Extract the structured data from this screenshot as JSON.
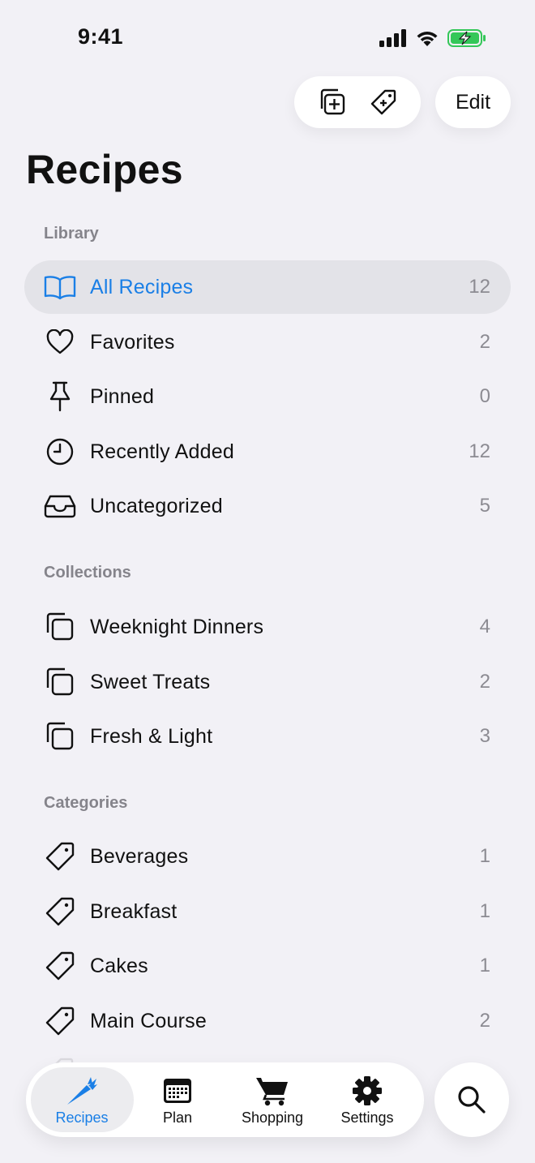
{
  "status": {
    "time": "9:41"
  },
  "toolbar": {
    "edit_label": "Edit"
  },
  "page": {
    "title": "Recipes"
  },
  "library": {
    "header": "Library",
    "items": [
      {
        "label": "All Recipes",
        "count": "12",
        "icon": "book-icon",
        "selected": true
      },
      {
        "label": "Favorites",
        "count": "2",
        "icon": "heart-icon"
      },
      {
        "label": "Pinned",
        "count": "0",
        "icon": "pin-icon"
      },
      {
        "label": "Recently Added",
        "count": "12",
        "icon": "clock-icon"
      },
      {
        "label": "Uncategorized",
        "count": "5",
        "icon": "inbox-icon"
      }
    ]
  },
  "collections": {
    "header": "Collections",
    "items": [
      {
        "label": "Weeknight Dinners",
        "count": "4",
        "icon": "collection-icon"
      },
      {
        "label": "Sweet Treats",
        "count": "2",
        "icon": "collection-icon"
      },
      {
        "label": "Fresh & Light",
        "count": "3",
        "icon": "collection-icon"
      }
    ]
  },
  "categories": {
    "header": "Categories",
    "items": [
      {
        "label": "Beverages",
        "count": "1",
        "icon": "tag-icon"
      },
      {
        "label": "Breakfast",
        "count": "1",
        "icon": "tag-icon"
      },
      {
        "label": "Cakes",
        "count": "1",
        "icon": "tag-icon"
      },
      {
        "label": "Main Course",
        "count": "2",
        "icon": "tag-icon"
      }
    ]
  },
  "tabs": [
    {
      "label": "Recipes",
      "icon": "carrot-icon",
      "active": true
    },
    {
      "label": "Plan",
      "icon": "calendar-icon"
    },
    {
      "label": "Shopping",
      "icon": "cart-icon"
    },
    {
      "label": "Settings",
      "icon": "gear-icon"
    }
  ],
  "colors": {
    "accent": "#1a7fe6",
    "background": "#f2f1f6",
    "selected_row": "#e3e3e8"
  }
}
